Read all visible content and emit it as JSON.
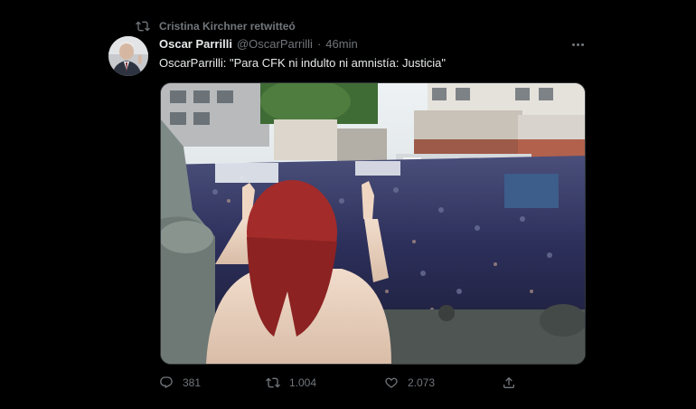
{
  "retweet": {
    "icon": "retweet-icon",
    "text": "Cristina Kirchner retwitteó"
  },
  "author": {
    "name": "Oscar Parrilli",
    "handle": "@OscarParrilli",
    "separator": "·",
    "time": "46min",
    "avatar_icon": "avatar"
  },
  "tweet": {
    "text": "OscarParrilli: \"Para CFK ni indulto ni amnistía: Justicia\""
  },
  "media": {
    "kind": "photo"
  },
  "actions": {
    "reply": {
      "icon": "reply-icon",
      "count": "381"
    },
    "retweet": {
      "icon": "retweet-icon",
      "count": "1.004"
    },
    "like": {
      "icon": "heart-icon",
      "count": "2.073"
    },
    "share": {
      "icon": "share-icon"
    }
  },
  "colors": {
    "background": "#000000",
    "text": "#e7e9ea",
    "secondary": "#71767b",
    "border": "#2f3336"
  }
}
